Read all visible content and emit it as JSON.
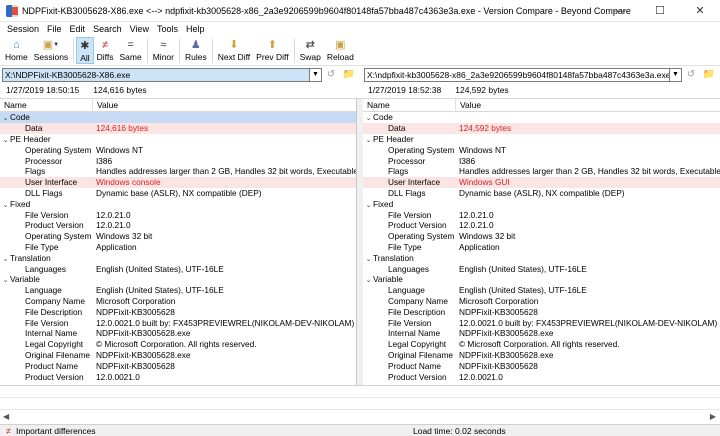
{
  "window": {
    "title": "NDPFixit-KB3005628-X86.exe <--> ndpfixit-kb3005628-x86_2a3e9206599b9604f80148fa57bba487c4363e3a.exe - Version Compare - Beyond Compare"
  },
  "menu": [
    "Session",
    "File",
    "Edit",
    "Search",
    "View",
    "Tools",
    "Help"
  ],
  "toolbar": {
    "home": "Home",
    "sessions": "Sessions",
    "all": "All",
    "diffs": "Diffs",
    "same": "Same",
    "minor": "Minor",
    "rules": "Rules",
    "next_diff": "Next Diff",
    "prev_diff": "Prev Diff",
    "swap": "Swap",
    "reload": "Reload"
  },
  "left": {
    "path": "X:\\NDPFixit-KB3005628-X86.exe",
    "date": "1/27/2019 18:50:15",
    "size": "124,616 bytes"
  },
  "right": {
    "path": "X:\\ndpfixit-kb3005628-x86_2a3e9206599b9604f80148fa57bba487c4363e3a.exe",
    "date": "1/27/2019 18:52:38",
    "size": "124,592 bytes"
  },
  "columns": {
    "name": "Name",
    "value": "Value"
  },
  "rows_left": [
    {
      "name": "Code",
      "value": "",
      "group": true,
      "sel": true
    },
    {
      "name": "Data",
      "value": "124,616 bytes",
      "diff": true
    },
    {
      "name": "PE Header",
      "value": "",
      "group": true
    },
    {
      "name": "Operating System",
      "value": "Windows NT"
    },
    {
      "name": "Processor",
      "value": "I386"
    },
    {
      "name": "Flags",
      "value": "Handles addresses larger than 2 GB, Handles 32 bit words, Executable"
    },
    {
      "name": "User Interface",
      "value": "Windows console",
      "diff": true
    },
    {
      "name": "DLL Flags",
      "value": "Dynamic base (ASLR), NX compatible (DEP)"
    },
    {
      "name": "Fixed",
      "value": "",
      "group": true
    },
    {
      "name": "File Version",
      "value": "12.0.21.0"
    },
    {
      "name": "Product Version",
      "value": "12.0.21.0"
    },
    {
      "name": "Operating System",
      "value": "Windows 32 bit"
    },
    {
      "name": "File Type",
      "value": "Application"
    },
    {
      "name": "Translation",
      "value": "",
      "group": true
    },
    {
      "name": "Languages",
      "value": "English (United States), UTF-16LE"
    },
    {
      "name": "Variable",
      "value": "",
      "group": true
    },
    {
      "name": "Language",
      "value": "English (United States), UTF-16LE"
    },
    {
      "name": "Company Name",
      "value": "Microsoft Corporation"
    },
    {
      "name": "File Description",
      "value": "NDPFixit-KB3005628"
    },
    {
      "name": "File Version",
      "value": "12.0.0021.0 built by: FX453PREVIEWREL(NIKOLAM-DEV-NIKOLAM)"
    },
    {
      "name": "Internal Name",
      "value": "NDPFixit-KB3005628.exe"
    },
    {
      "name": "Legal Copyright",
      "value": "© Microsoft Corporation. All rights reserved."
    },
    {
      "name": "Original Filename",
      "value": "NDPFixit-KB3005628.exe"
    },
    {
      "name": "Product Name",
      "value": "NDPFixit-KB3005628"
    },
    {
      "name": "Product Version",
      "value": "12.0.0021.0"
    }
  ],
  "rows_right": [
    {
      "name": "Code",
      "value": "",
      "group": true
    },
    {
      "name": "Data",
      "value": "124,592 bytes",
      "diff": true
    },
    {
      "name": "PE Header",
      "value": "",
      "group": true
    },
    {
      "name": "Operating System",
      "value": "Windows NT"
    },
    {
      "name": "Processor",
      "value": "I386"
    },
    {
      "name": "Flags",
      "value": "Handles addresses larger than 2 GB, Handles 32 bit words, Executable"
    },
    {
      "name": "User Interface",
      "value": "Windows GUI",
      "diff": true
    },
    {
      "name": "DLL Flags",
      "value": "Dynamic base (ASLR), NX compatible (DEP)"
    },
    {
      "name": "Fixed",
      "value": "",
      "group": true
    },
    {
      "name": "File Version",
      "value": "12.0.21.0"
    },
    {
      "name": "Product Version",
      "value": "12.0.21.0"
    },
    {
      "name": "Operating System",
      "value": "Windows 32 bit"
    },
    {
      "name": "File Type",
      "value": "Application"
    },
    {
      "name": "Translation",
      "value": "",
      "group": true
    },
    {
      "name": "Languages",
      "value": "English (United States), UTF-16LE"
    },
    {
      "name": "Variable",
      "value": "",
      "group": true
    },
    {
      "name": "Language",
      "value": "English (United States), UTF-16LE"
    },
    {
      "name": "Company Name",
      "value": "Microsoft Corporation"
    },
    {
      "name": "File Description",
      "value": "NDPFixit-KB3005628"
    },
    {
      "name": "File Version",
      "value": "12.0.0021.0 built by: FX453PREVIEWREL(NIKOLAM-DEV-NIKOLAM)"
    },
    {
      "name": "Internal Name",
      "value": "NDPFixit-KB3005628.exe"
    },
    {
      "name": "Legal Copyright",
      "value": "© Microsoft Corporation. All rights reserved."
    },
    {
      "name": "Original Filename",
      "value": "NDPFixit-KB3005628.exe"
    },
    {
      "name": "Product Name",
      "value": "NDPFixit-KB3005628"
    },
    {
      "name": "Product Version",
      "value": "12.0.0021.0"
    }
  ],
  "status": {
    "filter": "Important differences",
    "load_time": "Load time: 0.02 seconds"
  },
  "colors": {
    "diff_text": "#e02020",
    "diff_bg": "#fbe4e4",
    "selection": "#c6daf3"
  }
}
